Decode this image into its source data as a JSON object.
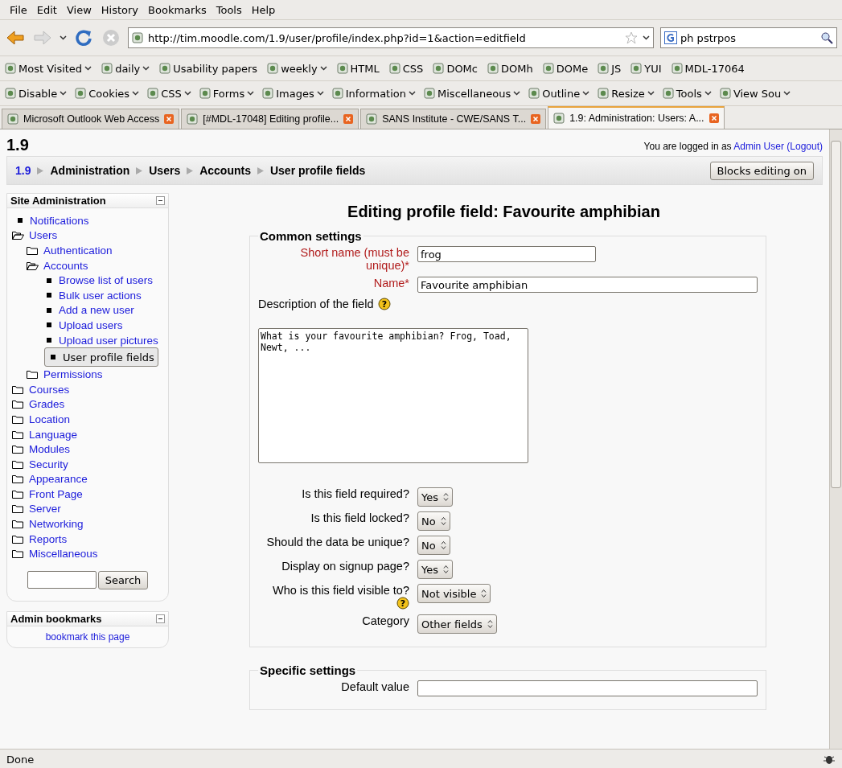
{
  "menubar": [
    "File",
    "Edit",
    "View",
    "History",
    "Bookmarks",
    "Tools",
    "Help"
  ],
  "navbar": {
    "url": "http://tim.moodle.com/1.9/user/profile/index.php?id=1&action=editfield",
    "search": "ph pstrpos"
  },
  "bookmarks": [
    {
      "label": "Most Visited",
      "menu": true
    },
    {
      "label": "daily",
      "menu": true
    },
    {
      "label": "Usability papers",
      "menu": false
    },
    {
      "label": "weekly",
      "menu": true
    },
    {
      "label": "HTML",
      "menu": false
    },
    {
      "label": "CSS",
      "menu": false
    },
    {
      "label": "DOMc",
      "menu": false
    },
    {
      "label": "DOMh",
      "menu": false
    },
    {
      "label": "DOMe",
      "menu": false
    },
    {
      "label": "JS",
      "menu": false
    },
    {
      "label": "YUI",
      "menu": false
    },
    {
      "label": "MDL-17064",
      "menu": false
    }
  ],
  "devtools": [
    "Disable",
    "Cookies",
    "CSS",
    "Forms",
    "Images",
    "Information",
    "Miscellaneous",
    "Outline",
    "Resize",
    "Tools",
    "View Sou"
  ],
  "tabs": [
    {
      "label": "Microsoft Outlook Web Access",
      "selected": false
    },
    {
      "label": "[#MDL-17048] Editing profile...",
      "selected": false
    },
    {
      "label": "SANS Institute - CWE/SANS T...",
      "selected": false
    },
    {
      "label": "1.9: Administration: Users: A...",
      "selected": true
    }
  ],
  "page": {
    "site": "1.9",
    "login": {
      "text": "You are logged in as",
      "user": "Admin User",
      "logout": "(Logout)"
    },
    "breadcrumb": [
      {
        "label": "1.9",
        "link": true
      },
      {
        "label": "Administration",
        "link": false
      },
      {
        "label": "Users",
        "link": false
      },
      {
        "label": "Accounts",
        "link": false
      },
      {
        "label": "User profile fields",
        "link": false
      }
    ],
    "editing_button": "Blocks editing on"
  },
  "sidebar": {
    "title": "Site Administration",
    "items": [
      {
        "label": "Notifications",
        "kind": "leaf",
        "selected": false
      },
      {
        "label": "Users",
        "kind": "folder",
        "expanded": true,
        "children": [
          {
            "label": "Authentication",
            "kind": "folder",
            "expanded": false
          },
          {
            "label": "Accounts",
            "kind": "folder",
            "expanded": true,
            "children": [
              {
                "label": "Browse list of users",
                "kind": "leaf",
                "selected": false
              },
              {
                "label": "Bulk user actions",
                "kind": "leaf",
                "selected": false
              },
              {
                "label": "Add a new user",
                "kind": "leaf",
                "selected": false
              },
              {
                "label": "Upload users",
                "kind": "leaf",
                "selected": false
              },
              {
                "label": "Upload user pictures",
                "kind": "leaf",
                "selected": false
              },
              {
                "label": "User profile fields",
                "kind": "leaf",
                "selected": true
              }
            ]
          },
          {
            "label": "Permissions",
            "kind": "folder",
            "expanded": false
          }
        ]
      },
      {
        "label": "Courses",
        "kind": "folder",
        "expanded": false
      },
      {
        "label": "Grades",
        "kind": "folder",
        "expanded": false
      },
      {
        "label": "Location",
        "kind": "folder",
        "expanded": false
      },
      {
        "label": "Language",
        "kind": "folder",
        "expanded": false
      },
      {
        "label": "Modules",
        "kind": "folder",
        "expanded": false
      },
      {
        "label": "Security",
        "kind": "folder",
        "expanded": false
      },
      {
        "label": "Appearance",
        "kind": "folder",
        "expanded": false
      },
      {
        "label": "Front Page",
        "kind": "folder",
        "expanded": false
      },
      {
        "label": "Server",
        "kind": "folder",
        "expanded": false
      },
      {
        "label": "Networking",
        "kind": "folder",
        "expanded": false
      },
      {
        "label": "Reports",
        "kind": "folder",
        "expanded": false
      },
      {
        "label": "Miscellaneous",
        "kind": "folder",
        "expanded": false
      }
    ],
    "search_button": "Search"
  },
  "bookmarks_block": {
    "title": "Admin bookmarks",
    "link": "bookmark this page"
  },
  "heading": "Editing profile field: Favourite amphibian",
  "sections": [
    {
      "legend": "Common settings",
      "fields": [
        {
          "kind": "text",
          "label": "Short name (must be unique)*",
          "required": true,
          "value": "frog"
        },
        {
          "kind": "text",
          "label": "Name*",
          "required": true,
          "value": "Favourite amphibian"
        },
        {
          "kind": "textarea",
          "label": "Description of the field",
          "help": "?",
          "value": "What is your favourite amphibian? Frog, Toad, Newt, ..."
        },
        {
          "kind": "select",
          "label": "Is this field required?",
          "value": "Yes"
        },
        {
          "kind": "select",
          "label": "Is this field locked?",
          "value": "No"
        },
        {
          "kind": "select",
          "label": "Should the data be unique?",
          "value": "No"
        },
        {
          "kind": "select",
          "label": "Display on signup page?",
          "value": "Yes"
        },
        {
          "kind": "select",
          "label": "Who is this field visible to?",
          "help": "?",
          "value": "Not visible"
        },
        {
          "kind": "select",
          "label": "Category",
          "value": "Other fields"
        }
      ]
    },
    {
      "legend": "Specific settings",
      "fields": [
        {
          "kind": "text",
          "label": "Default value"
        }
      ]
    }
  ],
  "status": "Done"
}
